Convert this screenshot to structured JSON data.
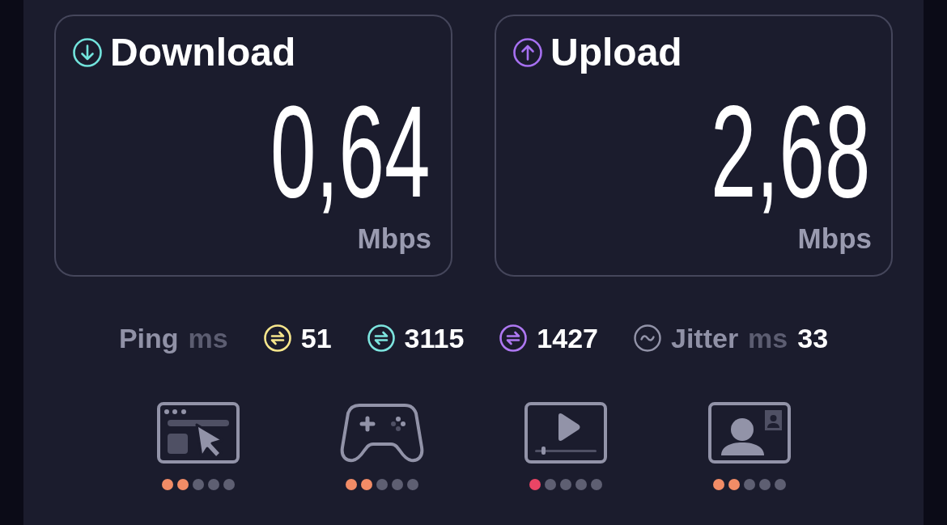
{
  "cards": [
    {
      "kind": "download",
      "label": "Download",
      "value": "0,64",
      "unit": "Mbps",
      "color": "#72e3dc"
    },
    {
      "kind": "upload",
      "label": "Upload",
      "value": "2,68",
      "unit": "Mbps",
      "color": "#a670f0"
    }
  ],
  "latency": {
    "label": "Ping",
    "unit": "ms",
    "readings": [
      {
        "value": "51",
        "color": "#f7e68c"
      },
      {
        "value": "3115",
        "color": "#7de5df"
      },
      {
        "value": "1427",
        "color": "#ae78f2"
      }
    ]
  },
  "jitter": {
    "label": "Jitter",
    "unit": "ms",
    "value": "33"
  },
  "activities": [
    {
      "kind": "browsing",
      "stars": 2,
      "color": "#f28c66"
    },
    {
      "kind": "gaming",
      "stars": 2,
      "color": "#f28c66"
    },
    {
      "kind": "streaming",
      "stars": 1,
      "color": "#ea4565"
    },
    {
      "kind": "video_call",
      "stars": 2,
      "color": "#f28c66"
    }
  ]
}
